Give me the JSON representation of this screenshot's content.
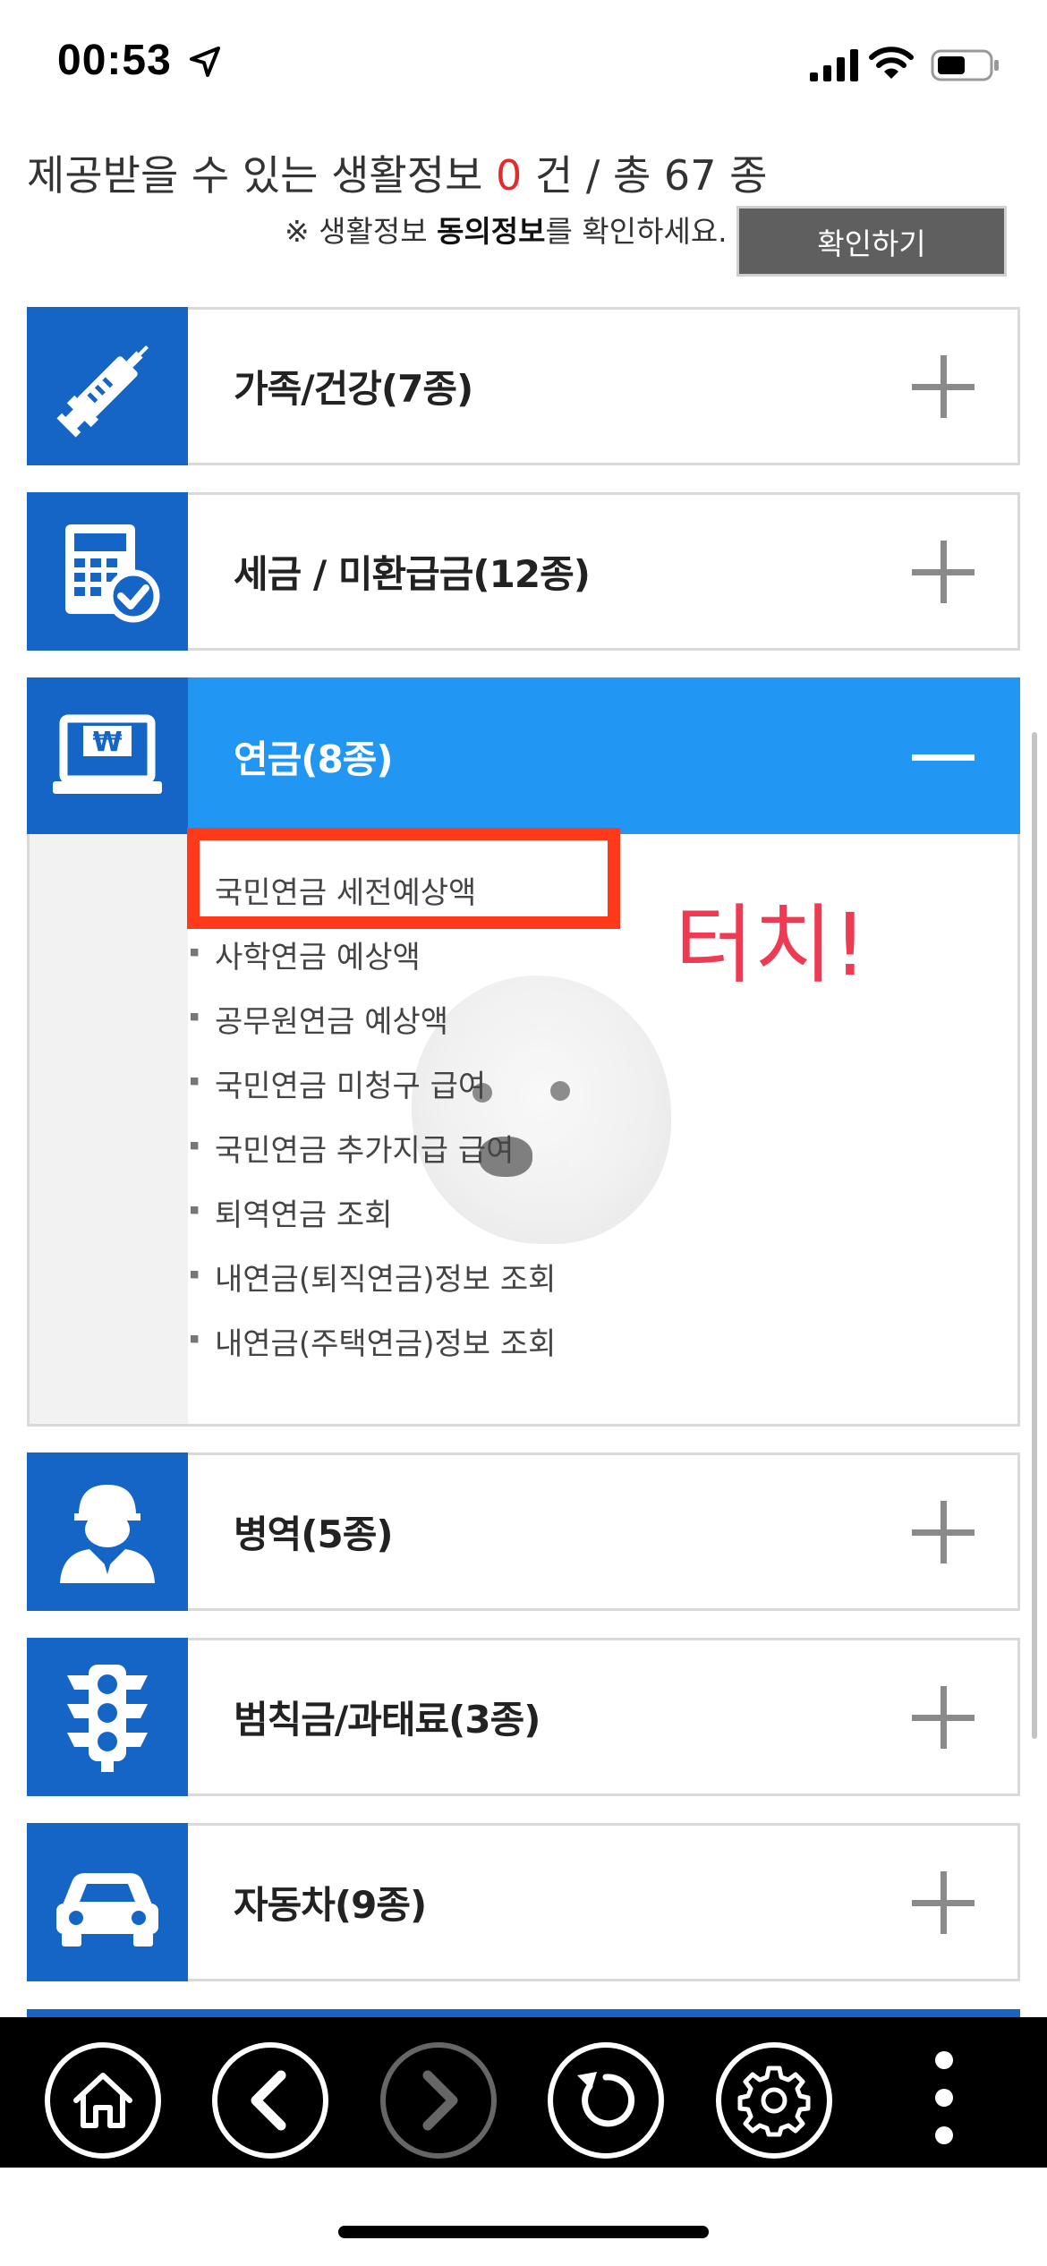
{
  "status_bar": {
    "time": "00:53"
  },
  "summary": {
    "prefix": "제공받을 수 있는 생활정보 ",
    "count": "0",
    "suffix": " 건 / 총 67 종"
  },
  "notice": {
    "prefix": "※ 생활정보 ",
    "bold": "동의정보",
    "suffix": "를 확인하세요."
  },
  "confirm_button": "확인하기",
  "categories": [
    {
      "label": "가족/건강(7종)",
      "icon": "syringe-icon",
      "state": "collapsed"
    },
    {
      "label": "세금 / 미환급금(12종)",
      "icon": "calculator-check-icon",
      "state": "collapsed"
    },
    {
      "label": "연금(8종)",
      "icon": "laptop-won-icon",
      "state": "expanded"
    },
    {
      "label": "병역(5종)",
      "icon": "soldier-icon",
      "state": "collapsed"
    },
    {
      "label": "범칙금/과태료(3종)",
      "icon": "traffic-light-icon",
      "state": "collapsed"
    },
    {
      "label": "자동차(9종)",
      "icon": "car-icon",
      "state": "collapsed"
    }
  ],
  "pension_items": [
    "국민연금 세전예상액",
    "사학연금 예상액",
    "공무원연금 예상액",
    "국민연금 미청구 급여",
    "국민연금 추가지급 급여",
    "퇴역연금 조회",
    "내연금(퇴직연금)정보 조회",
    "내연금(주택연금)정보 조회"
  ],
  "annotation": {
    "text": "터치!",
    "color": "#ee3a52",
    "box_color": "#ff3a1a"
  },
  "colors": {
    "icon_bg": "#1565c7",
    "open_bg": "#2196f3",
    "count_red": "#e32b2b"
  },
  "toolbar": [
    "home-icon",
    "back-icon",
    "forward-icon",
    "refresh-icon",
    "settings-icon",
    "more-icon"
  ]
}
